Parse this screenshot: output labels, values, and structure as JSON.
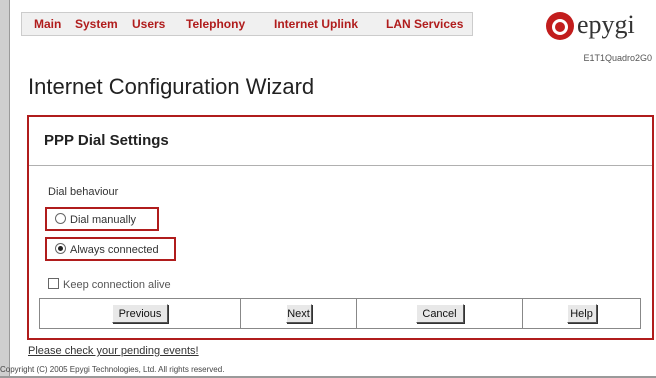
{
  "nav": {
    "items": [
      "Main",
      "System",
      "Users",
      "Telephony",
      "Internet Uplink",
      "LAN Services"
    ]
  },
  "brand": {
    "logo_text": "epygi",
    "model": "E1T1Quadro2G0",
    "accent_color": "#b01c1c"
  },
  "page": {
    "title": "Internet Configuration Wizard"
  },
  "panel": {
    "title": "PPP Dial Settings",
    "dial_label": "Dial behaviour",
    "options": [
      {
        "label": "Dial manually",
        "selected": false
      },
      {
        "label": "Always connected",
        "selected": true
      }
    ],
    "keep_alive_label": "Keep connection alive",
    "keep_alive_checked": false
  },
  "buttons": {
    "previous": "Previous",
    "next": "Next",
    "cancel": "Cancel",
    "help": "Help"
  },
  "footer": {
    "pending_link": "Please check your pending events!",
    "copyright": "Copyright (C) 2005 Epygi Technologies, Ltd. All rights reserved."
  }
}
